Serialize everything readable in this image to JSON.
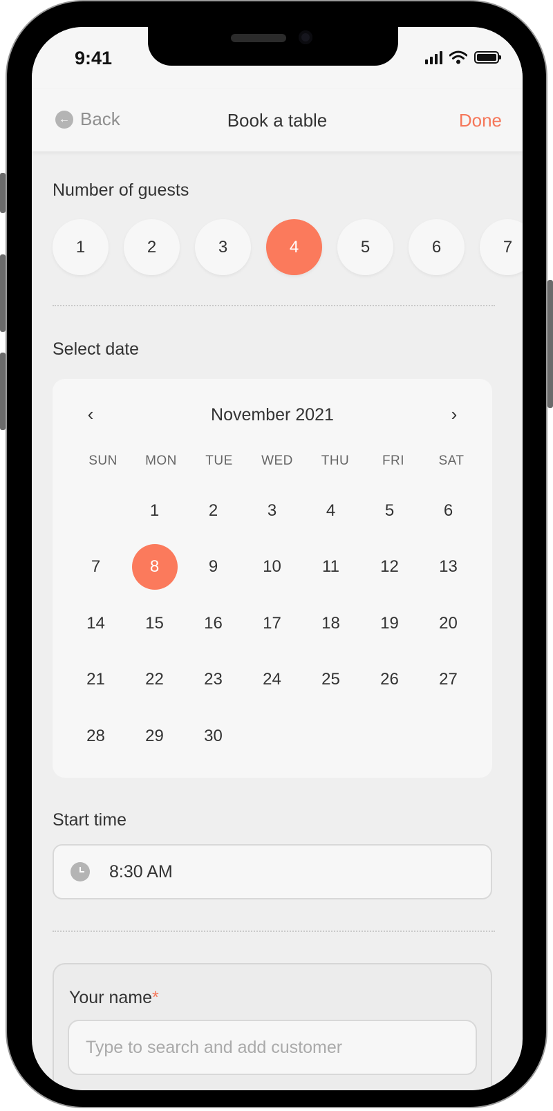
{
  "status_bar": {
    "time": "9:41"
  },
  "nav": {
    "back_label": "Back",
    "title": "Book a table",
    "done_label": "Done"
  },
  "guests": {
    "label": "Number of guests",
    "options": [
      "1",
      "2",
      "3",
      "4",
      "5",
      "6",
      "7"
    ],
    "selected": "4"
  },
  "date": {
    "label": "Select date",
    "month_label": "November 2021",
    "prev_icon": "‹",
    "next_icon": "›",
    "weekdays": [
      "SUN",
      "MON",
      "TUE",
      "WED",
      "THU",
      "FRI",
      "SAT"
    ],
    "days": [
      "",
      "1",
      "2",
      "3",
      "4",
      "5",
      "6",
      "7",
      "8",
      "9",
      "10",
      "11",
      "12",
      "13",
      "14",
      "15",
      "16",
      "17",
      "18",
      "19",
      "20",
      "21",
      "22",
      "23",
      "24",
      "25",
      "26",
      "27",
      "28",
      "29",
      "30"
    ],
    "selected": "8"
  },
  "start_time": {
    "label": "Start time",
    "value": "8:30 AM",
    "icon": "clock-icon"
  },
  "customer": {
    "label": "Your name",
    "required_mark": "*",
    "placeholder": "Type to search and add customer"
  },
  "colors": {
    "accent": "#fb7a5c",
    "background": "#efefef",
    "surface": "#f7f7f7"
  }
}
